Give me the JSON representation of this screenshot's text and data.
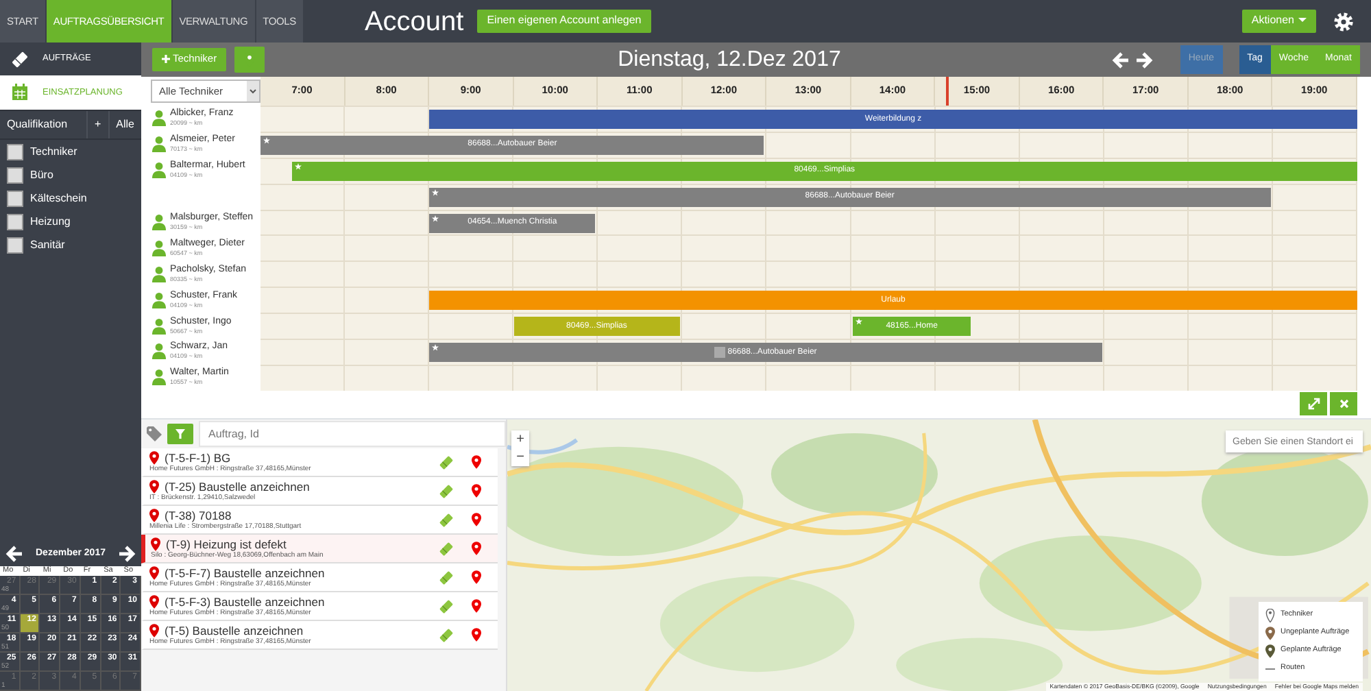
{
  "top_nav": [
    {
      "label": "START",
      "selected": false
    },
    {
      "label": "AUFTRAGSÜBERSICHT",
      "selected": true
    },
    {
      "label": "VERWALTUNG",
      "selected": false
    },
    {
      "label": "TOOLS",
      "selected": false
    }
  ],
  "header": {
    "title": "Account",
    "create_button": "Einen eigenen Account anlegen",
    "actions_button": "Aktionen"
  },
  "sidebar": {
    "items": [
      {
        "label": "AUFTRÄGE",
        "kind": "orders",
        "selected": false
      },
      {
        "label": "EINSATZPLANUNG",
        "kind": "planning",
        "selected": true
      }
    ],
    "filter": {
      "label": "Qualifikation",
      "add": "+",
      "all": "Alle"
    },
    "qualifications": [
      {
        "label": "Techniker",
        "checked": false
      },
      {
        "label": "Büro",
        "checked": false
      },
      {
        "label": "Kälteschein",
        "checked": false
      },
      {
        "label": "Heizung",
        "checked": false
      },
      {
        "label": "Sanitär",
        "checked": false
      }
    ],
    "calendar": {
      "month": "Dezember 2017",
      "weekdays": [
        "Mo",
        "Di",
        "Mi",
        "Do",
        "Fr",
        "Sa",
        "So"
      ],
      "weeks": [
        {
          "number": "48",
          "days": [
            {
              "day": "27",
              "outside": true,
              "selected": false
            },
            {
              "day": "28",
              "outside": true,
              "selected": false
            },
            {
              "day": "29",
              "outside": true,
              "selected": false
            },
            {
              "day": "30",
              "outside": true,
              "selected": false
            },
            {
              "day": "1",
              "outside": false,
              "selected": false
            },
            {
              "day": "2",
              "outside": false,
              "selected": false
            },
            {
              "day": "3",
              "outside": false,
              "selected": false
            }
          ]
        },
        {
          "number": "49",
          "days": [
            {
              "day": "4",
              "outside": false,
              "selected": false
            },
            {
              "day": "5",
              "outside": false,
              "selected": false
            },
            {
              "day": "6",
              "outside": false,
              "selected": false
            },
            {
              "day": "7",
              "outside": false,
              "selected": false
            },
            {
              "day": "8",
              "outside": false,
              "selected": false
            },
            {
              "day": "9",
              "outside": false,
              "selected": false
            },
            {
              "day": "10",
              "outside": false,
              "selected": false
            }
          ]
        },
        {
          "number": "50",
          "days": [
            {
              "day": "11",
              "outside": false,
              "selected": false
            },
            {
              "day": "12",
              "outside": false,
              "selected": true
            },
            {
              "day": "13",
              "outside": false,
              "selected": false
            },
            {
              "day": "14",
              "outside": false,
              "selected": false
            },
            {
              "day": "15",
              "outside": false,
              "selected": false
            },
            {
              "day": "16",
              "outside": false,
              "selected": false
            },
            {
              "day": "17",
              "outside": false,
              "selected": false
            }
          ]
        },
        {
          "number": "51",
          "days": [
            {
              "day": "18",
              "outside": false,
              "selected": false
            },
            {
              "day": "19",
              "outside": false,
              "selected": false
            },
            {
              "day": "20",
              "outside": false,
              "selected": false
            },
            {
              "day": "21",
              "outside": false,
              "selected": false
            },
            {
              "day": "22",
              "outside": false,
              "selected": false
            },
            {
              "day": "23",
              "outside": false,
              "selected": false
            },
            {
              "day": "24",
              "outside": false,
              "selected": false
            }
          ]
        },
        {
          "number": "52",
          "days": [
            {
              "day": "25",
              "outside": false,
              "selected": false
            },
            {
              "day": "26",
              "outside": false,
              "selected": false
            },
            {
              "day": "27",
              "outside": false,
              "selected": false
            },
            {
              "day": "28",
              "outside": false,
              "selected": false
            },
            {
              "day": "29",
              "outside": false,
              "selected": false
            },
            {
              "day": "30",
              "outside": false,
              "selected": false
            },
            {
              "day": "31",
              "outside": false,
              "selected": false
            }
          ]
        },
        {
          "number": "1",
          "days": [
            {
              "day": "1",
              "outside": true,
              "selected": false
            },
            {
              "day": "2",
              "outside": true,
              "selected": false
            },
            {
              "day": "3",
              "outside": true,
              "selected": false
            },
            {
              "day": "4",
              "outside": true,
              "selected": false
            },
            {
              "day": "5",
              "outside": true,
              "selected": false
            },
            {
              "day": "6",
              "outside": true,
              "selected": false
            },
            {
              "day": "7",
              "outside": true,
              "selected": false
            }
          ]
        }
      ]
    }
  },
  "toolbar": {
    "add_button": "Techniker",
    "date": "Dienstag, 12.Dez 2017",
    "today_button": {
      "label": "Heute",
      "disabled": true
    },
    "views": [
      {
        "label": "Tag",
        "selected": true
      },
      {
        "label": "Woche",
        "selected": false
      },
      {
        "label": "Monat",
        "selected": false
      }
    ]
  },
  "schedule": {
    "filter": "Alle Techniker",
    "hours": [
      "7:00",
      "8:00",
      "9:00",
      "10:00",
      "11:00",
      "12:00",
      "13:00",
      "14:00",
      "15:00",
      "16:00",
      "17:00",
      "18:00",
      "19:00"
    ],
    "rows": [
      {
        "name": "Albicker, Franz",
        "distance": "20099 ~ km",
        "bars": [
          {
            "label": "Weiterbildung z",
            "color": "#3d5ca8",
            "starred": false,
            "noted": false
          }
        ]
      },
      {
        "name": "Alsmeier, Peter",
        "distance": "70173 ~ km",
        "bars": [
          {
            "label": "86688...Autobauer Beier",
            "color": "#808080",
            "starred": true,
            "noted": false
          }
        ]
      },
      {
        "name": "Baltermar, Hubert",
        "distance": "04109 ~ km",
        "bars": [
          {
            "label": "80469...Simplias",
            "color": "#6bb52c",
            "starred": true,
            "noted": false
          }
        ]
      },
      {
        "bars": [
          {
            "label": "86688...Autobauer Beier",
            "color": "#808080",
            "starred": true,
            "noted": false
          }
        ]
      },
      {
        "name": "Malsburger, Steffen",
        "distance": "30159 ~ km",
        "bars": [
          {
            "label": "04654...Muench Christia",
            "color": "#808080",
            "starred": true,
            "noted": false
          }
        ]
      },
      {
        "name": "Maltweger, Dieter",
        "distance": "60547 ~ km",
        "bars": []
      },
      {
        "name": "Pacholsky, Stefan",
        "distance": "80335 ~ km",
        "bars": []
      },
      {
        "name": "Schuster, Frank",
        "distance": "04109 ~ km",
        "bars": [
          {
            "label": "Urlaub",
            "color": "#f39200",
            "starred": false,
            "noted": false
          }
        ]
      },
      {
        "name": "Schuster, Ingo",
        "distance": "50667 ~ km",
        "bars": [
          {
            "label": "80469...Simplias",
            "color": "#b5b51a",
            "starred": false,
            "noted": false
          },
          {
            "label": "48165...Home",
            "color": "#6bb52c",
            "starred": true,
            "noted": false
          }
        ]
      },
      {
        "name": "Schwarz, Jan",
        "distance": "04109 ~ km",
        "bars": [
          {
            "label": "86688...Autobauer Beier",
            "color": "#808080",
            "starred": true,
            "noted": true
          }
        ]
      },
      {
        "name": "Walter, Martin",
        "distance": "10557 ~ km",
        "bars": []
      }
    ]
  },
  "orders": {
    "search": {
      "placeholder": "Auftrag, Id"
    },
    "items": [
      {
        "title": "(T-5-F-1) BG",
        "address": "Home Futures GmbH : Ringstraße 37,48165,Münster",
        "selected": false
      },
      {
        "title": "(T-25) Baustelle anzeichnen",
        "address": "IT : Brückenstr. 1,29410,Salzwedel",
        "selected": false
      },
      {
        "title": "(T-38) 70188",
        "address": "Millenia Life : Strombergstraße 17,70188,Stuttgart",
        "selected": false
      },
      {
        "title": "(T-9) Heizung ist defekt",
        "address": "Silo : Georg-Büchner-Weg 18,63069,Offenbach am Main",
        "selected": true
      },
      {
        "title": "(T-5-F-7) Baustelle anzeichnen",
        "address": "Home Futures GmbH : Ringstraße 37,48165,Münster",
        "selected": false
      },
      {
        "title": "(T-5-F-3) Baustelle anzeichnen",
        "address": "Home Futures GmbH : Ringstraße 37,48165,Münster",
        "selected": false
      },
      {
        "title": "(T-5) Baustelle anzeichnen",
        "address": "Home Futures GmbH : Ringstraße 37,48165,Münster",
        "selected": false
      }
    ]
  },
  "map": {
    "kind": "picture",
    "zoom_in": "+",
    "zoom_out": "−",
    "search": {
      "placeholder": "Geben Sie einen Standort ei"
    },
    "legend": [
      {
        "label": "Techniker",
        "kind": "technician"
      },
      {
        "label": "Ungeplante Aufträge",
        "kind": "unplanned"
      },
      {
        "label": "Geplante Aufträge",
        "kind": "planned"
      },
      {
        "label": "Routen",
        "kind": "route"
      }
    ],
    "attribution": [
      "Kartendaten © 2017 GeoBasis-DE/BKG (©2009), Google",
      "Nutzungsbedingungen",
      "Fehler bei Google Maps melden"
    ]
  }
}
